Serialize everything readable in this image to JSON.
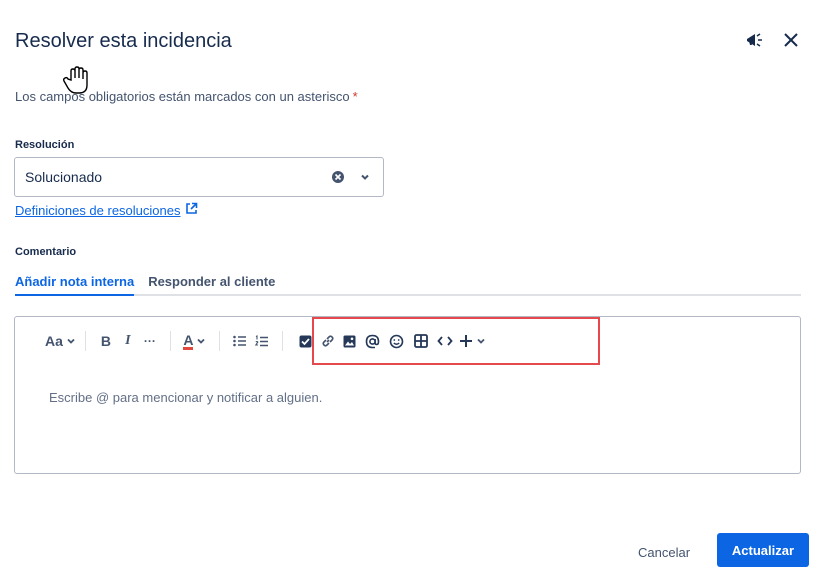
{
  "dialog": {
    "title": "Resolver esta incidencia",
    "required_note": "Los campos obligatorios están marcados con un asterisco",
    "required_asterisk": "*"
  },
  "resolution": {
    "label": "Resolución",
    "value": "Solucionado",
    "definitions_link": "Definiciones de resoluciones"
  },
  "comment": {
    "label": "Comentario",
    "tabs": [
      {
        "label": "Añadir nota interna",
        "active": true
      },
      {
        "label": "Responder al cliente",
        "active": false
      }
    ],
    "placeholder": "Escribe @ para mencionar y notificar a alguien.",
    "toolbar": {
      "text_style_label": "Aa",
      "bold_label": "B",
      "italic_label": "I",
      "more_label": "···",
      "text_color_label": "A",
      "text_color_underline": "#e2483d",
      "icons": [
        "text-style-icon",
        "bold-icon",
        "italic-icon",
        "more-formatting-icon",
        "text-color-icon",
        "bullet-list-icon",
        "numbered-list-icon",
        "action-item-icon",
        "link-icon",
        "image-icon",
        "mention-icon",
        "emoji-icon",
        "table-icon",
        "code-icon",
        "insert-plus-icon"
      ]
    }
  },
  "footer": {
    "cancel_label": "Cancelar",
    "submit_label": "Actualizar"
  },
  "colors": {
    "primary": "#0c66e4",
    "text": "#172b4d",
    "highlight_box": "#e5484d",
    "required": "#c9372c"
  }
}
